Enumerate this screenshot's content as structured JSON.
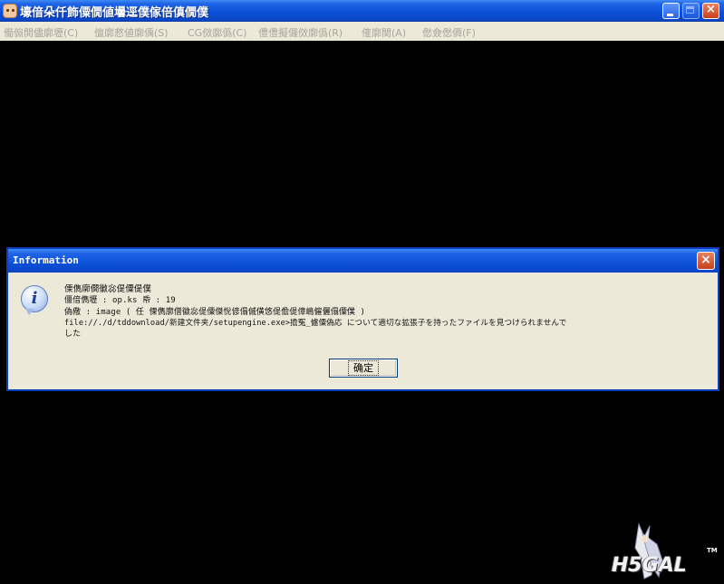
{
  "window": {
    "title": "壕偣朵仟飾僳僩値壜逕僕傢倍傎僩僕",
    "buttons": {
      "minimize": "minimize",
      "maximize": "maximize",
      "close": "×"
    }
  },
  "menu": {
    "items": [
      "僃傓閧儘廓壢(C)",
      "儃廓慦値廓偊(S)",
      "CG傚廓僞(C)",
      "僼僼擬儸傚廓僞(R)",
      "傕廓関(A)",
      "僽僉僽僲(F)"
    ]
  },
  "dialog": {
    "title": "Information",
    "close_label": "×",
    "icon_glyph": "i",
    "lines": [
      "傈儁廓僩徽惢偍僳偍僕",
      "僵偣儁壢 : op.ks   帋 : 19",
      "偽儆 : image ( 任 傈儁廓僧徽惢偍僳傑恱偐傝傶僙悠偍儋偍傽嶋僱儷傝僳僕 )",
      "file://./d/tddownload/新建文件夹/setupengine.exe>擔冤_儢僳偽応 について適切な拡張子を持ったファイルを見つけられませんで",
      "した"
    ],
    "ok_label": "确定"
  },
  "logo": {
    "text": "H5GAL",
    "tm": "TM"
  }
}
